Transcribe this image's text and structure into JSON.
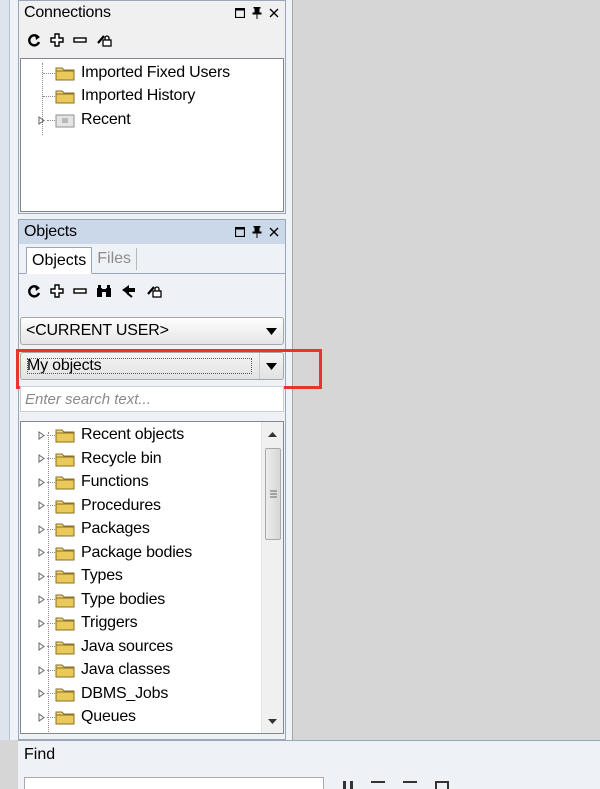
{
  "connections": {
    "title": "Connections",
    "tree": [
      {
        "label": "Imported Fixed Users",
        "type": "folder",
        "expandable": false
      },
      {
        "label": "Imported History",
        "type": "folder",
        "expandable": false
      },
      {
        "label": "Recent",
        "type": "recent-folder",
        "expandable": true
      }
    ]
  },
  "objects": {
    "title": "Objects",
    "tabs": [
      {
        "label": "Objects",
        "active": true
      },
      {
        "label": "Files",
        "active": false
      }
    ],
    "user_select": "<CURRENT USER>",
    "filter_select": "My objects",
    "search_placeholder": "Enter search text...",
    "tree": [
      {
        "label": "Recent objects"
      },
      {
        "label": "Recycle bin"
      },
      {
        "label": "Functions"
      },
      {
        "label": "Procedures"
      },
      {
        "label": "Packages"
      },
      {
        "label": "Package bodies"
      },
      {
        "label": "Types"
      },
      {
        "label": "Type bodies"
      },
      {
        "label": "Triggers"
      },
      {
        "label": "Java sources"
      },
      {
        "label": "Java classes"
      },
      {
        "label": "DBMS_Jobs"
      },
      {
        "label": "Queues"
      }
    ]
  },
  "find": {
    "title": "Find"
  },
  "icons": {
    "toolbar_connections": [
      "refresh-icon",
      "add-icon",
      "remove-icon",
      "properties-icon"
    ],
    "toolbar_objects": [
      "refresh-icon",
      "add-icon",
      "remove-icon",
      "find-icon",
      "filter-icon",
      "properties-icon"
    ],
    "header": [
      "float-icon",
      "pin-icon",
      "close-icon"
    ]
  },
  "colors": {
    "highlight": "#e8342c",
    "active_header": "#cbd8ea",
    "folder": "#e8c95a"
  }
}
